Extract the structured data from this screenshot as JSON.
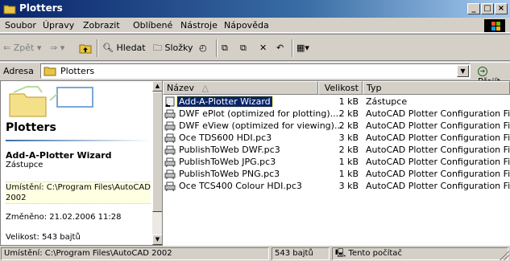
{
  "window": {
    "title": "Plotters"
  },
  "menu": [
    {
      "label": "Soubor"
    },
    {
      "label": "Úpravy"
    },
    {
      "label": "Zobrazit"
    },
    {
      "label": "Oblíbené"
    },
    {
      "label": "Nástroje"
    },
    {
      "label": "Nápověda"
    }
  ],
  "toolbar": {
    "back": "Zpět",
    "search": "Hledat",
    "folders": "Složky"
  },
  "address": {
    "label": "Adresa",
    "value": "Plotters",
    "go": "Přejít"
  },
  "left_pane": {
    "title": "Plotters",
    "item_name": "Add-A-Plotter Wizard",
    "item_type": "Zástupce",
    "location": "Umístění: C:\\Program Files\\AutoCAD 2002",
    "modified": "Změněno: 21.02.2006 11:28",
    "size": "Velikost: 543 bajtů"
  },
  "columns": {
    "name": "Název",
    "size": "Velikost",
    "type": "Typ"
  },
  "files": [
    {
      "name": "Add-A-Plotter Wizard",
      "size": "1 kB",
      "type": "Zástupce",
      "selected": true
    },
    {
      "name": "DWF ePlot (optimized for plotting)....",
      "size": "2 kB",
      "type": "AutoCAD Plotter Configuration File"
    },
    {
      "name": "DWF eView (optimized for viewing)...",
      "size": "2 kB",
      "type": "AutoCAD Plotter Configuration File"
    },
    {
      "name": "Oce TDS600 HDI.pc3",
      "size": "3 kB",
      "type": "AutoCAD Plotter Configuration File"
    },
    {
      "name": "PublishToWeb DWF.pc3",
      "size": "2 kB",
      "type": "AutoCAD Plotter Configuration File"
    },
    {
      "name": "PublishToWeb JPG.pc3",
      "size": "1 kB",
      "type": "AutoCAD Plotter Configuration File"
    },
    {
      "name": "PublishToWeb PNG.pc3",
      "size": "1 kB",
      "type": "AutoCAD Plotter Configuration File"
    },
    {
      "name": "Oce TCS400 Colour HDI.pc3",
      "size": "3 kB",
      "type": "AutoCAD Plotter Configuration File"
    }
  ],
  "status": {
    "location": "Umístění: C:\\Program Files\\AutoCAD 2002",
    "size": "543 bajtů",
    "computer": "Tento počítač"
  },
  "colors": {
    "title_start": "#0a246a",
    "title_end": "#a6caf0",
    "selection": "#0a246a",
    "face": "#d4d0c8"
  }
}
